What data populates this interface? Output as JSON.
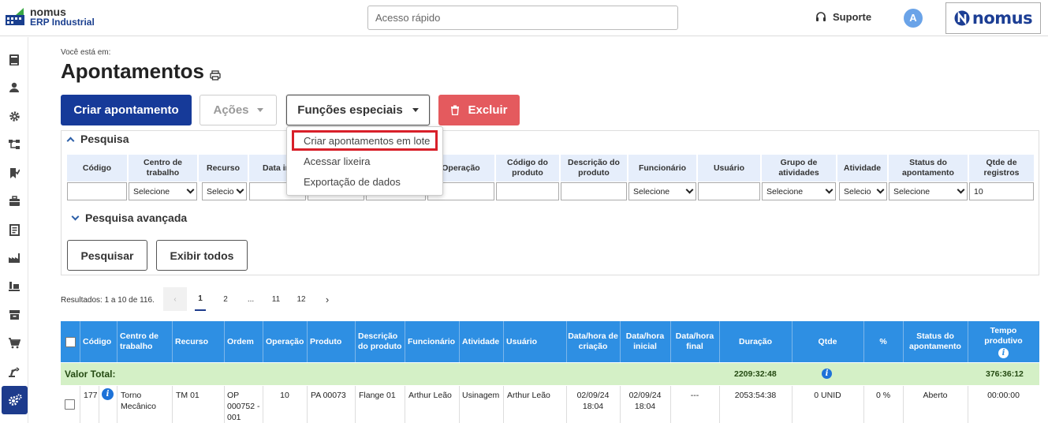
{
  "app": {
    "logo_line1": "nomus",
    "logo_line2": "ERP Industrial",
    "brand": "nomus"
  },
  "header": {
    "quick_placeholder": "Acesso rápido",
    "support": "Suporte",
    "avatar": "A"
  },
  "sidebar": {
    "icons": [
      "book-icon",
      "user-icon",
      "gear-icon",
      "flow-icon",
      "bookmark-check-icon",
      "briefcase-icon",
      "ledger-icon",
      "factory-icon",
      "conveyor-icon",
      "archive-icon",
      "cart-icon",
      "robot-arm-icon",
      "settings-gears-icon"
    ]
  },
  "page": {
    "breadcrumb": "Você está em:",
    "title": "Apontamentos"
  },
  "toolbar": {
    "create": "Criar apontamento",
    "acoes": "Ações",
    "funcoes": "Funções especiais",
    "excluir": "Excluir"
  },
  "dropdown": {
    "items": [
      "Criar apontamentos em lote",
      "Acessar lixeira",
      "Exportação de dados"
    ]
  },
  "search": {
    "title": "Pesquisa",
    "columns": [
      "Código",
      "Centro de trabalho",
      "Recurso",
      "Data ini",
      "",
      "",
      "Operação",
      "Código do produto",
      "Descrição do produto",
      "Funcionário",
      "Usuário",
      "Grupo de atividades",
      "Atividade",
      "Status do apontamento",
      "Qtde de registros"
    ],
    "select_placeholder": "Selecione",
    "select_short": "Selecio",
    "registros": "10",
    "advanced": "Pesquisa avançada",
    "btn_search": "Pesquisar",
    "btn_all": "Exibir todos"
  },
  "results": {
    "text": "Resultados: 1 a 10 de 116.",
    "pages": [
      "1",
      "2",
      "...",
      "11",
      "12"
    ]
  },
  "table": {
    "headers": [
      "Código",
      "Centro de trabalho",
      "Recurso",
      "Ordem",
      "Operação",
      "Produto",
      "Descrição do produto",
      "Funcionário",
      "Atividade",
      "Usuário",
      "Data/hora de criação",
      "Data/hora inicial",
      "Data/hora final",
      "Duração",
      "Qtde",
      "%",
      "Status do apontamento",
      "Tempo produtivo"
    ],
    "total_label": "Valor Total:",
    "total_duracao": "2209:32:48",
    "total_tempo": "376:36:12",
    "rows": [
      {
        "codigo": "177",
        "centro": "Torno Mecânico",
        "recurso": "TM 01",
        "ordem": "OP 000752 - 001",
        "operacao": "10",
        "produto": "PA 00073",
        "descricao": "Flange 01",
        "funcionario": "Arthur Leão",
        "atividade": "Usinagem",
        "usuario": "Arthur Leão",
        "criacao": "02/09/24 18:04",
        "inicial": "02/09/24 18:04",
        "final": "---",
        "duracao": "2053:54:38",
        "qtde": "0 UNID",
        "pct": "0 %",
        "status": "Aberto",
        "tempo": "00:00:00"
      }
    ]
  }
}
